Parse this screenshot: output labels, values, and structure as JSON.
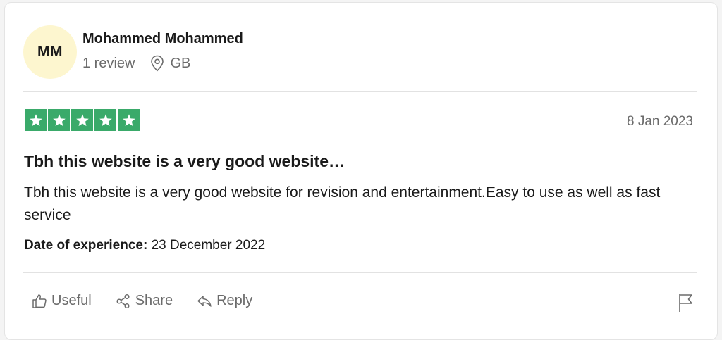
{
  "reviewer": {
    "initials": "MM",
    "name": "Mohammed Mohammed",
    "review_count": "1 review",
    "location": "GB"
  },
  "review": {
    "rating": 5,
    "rating_max": 5,
    "date": "8 Jan 2023",
    "title": "Tbh this website is a very good website…",
    "body": "Tbh this website is a very good website for revision and entertainment.Easy to use as well as fast service",
    "experience_label": "Date of experience:",
    "experience_date": "23 December 2022"
  },
  "actions": {
    "useful": "Useful",
    "share": "Share",
    "reply": "Reply"
  },
  "colors": {
    "star_green": "#3aaa6a",
    "avatar_bg": "#fdf6cf",
    "muted_text": "#6b6b6b"
  },
  "icons": [
    "location-pin-icon",
    "star-icon",
    "thumbs-up-icon",
    "share-icon",
    "reply-icon",
    "flag-icon"
  ]
}
